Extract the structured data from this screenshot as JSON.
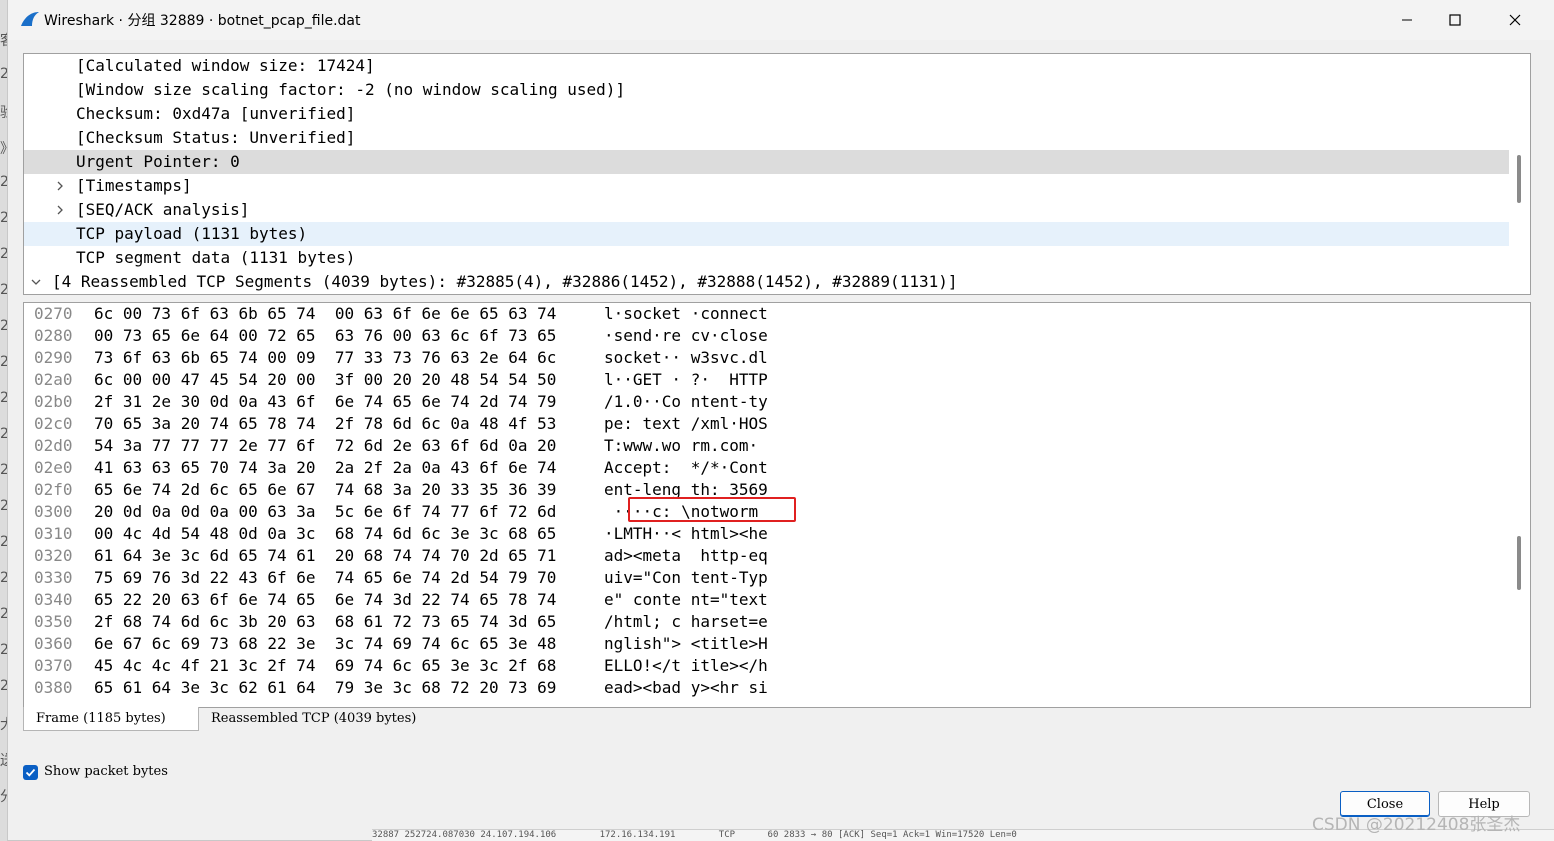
{
  "window": {
    "title": "Wireshark · 分组 32889 · botnet_pcap_file.dat"
  },
  "icons": {
    "app": "wireshark-fin-icon",
    "minimize": "minimize-icon",
    "maximize": "maximize-icon",
    "close": "close-icon",
    "collapsed": "chevron-right-icon",
    "expanded": "chevron-down-icon",
    "checkbox": "checkmark-icon"
  },
  "colors": {
    "accent": "#0a5fc4",
    "selected_row": "#dcdcdc",
    "highlight_row": "#e6f1fb",
    "annotation_box": "#e02020"
  },
  "tree": {
    "rows": [
      {
        "text": "[Calculated window size: 17424]",
        "state": "leaf"
      },
      {
        "text": "[Window size scaling factor: -2 (no window scaling used)]",
        "state": "leaf"
      },
      {
        "text": "Checksum: 0xd47a [unverified]",
        "state": "leaf"
      },
      {
        "text": "[Checksum Status: Unverified]",
        "state": "leaf"
      },
      {
        "text": "Urgent Pointer: 0",
        "state": "selected"
      },
      {
        "text": "[Timestamps]",
        "state": "collapsed"
      },
      {
        "text": "[SEQ/ACK analysis]",
        "state": "collapsed"
      },
      {
        "text": "TCP payload (1131 bytes)",
        "state": "highlighted"
      },
      {
        "text": "TCP segment data (1131 bytes)",
        "state": "leaf"
      },
      {
        "text": "[4 Reassembled TCP Segments (4039 bytes): #32885(4), #32886(1452), #32888(1452), #32889(1131)]",
        "state": "expanded"
      }
    ]
  },
  "hex": {
    "rows": [
      {
        "offset": "0270",
        "bytes": "6c 00 73 6f 63 6b 65 74  00 63 6f 6e 6e 65 63 74",
        "ascii": "l·socket ·connect"
      },
      {
        "offset": "0280",
        "bytes": "00 73 65 6e 64 00 72 65  63 76 00 63 6c 6f 73 65",
        "ascii": "·send·re cv·close"
      },
      {
        "offset": "0290",
        "bytes": "73 6f 63 6b 65 74 00 09  77 33 73 76 63 2e 64 6c",
        "ascii": "socket·· w3svc.dl"
      },
      {
        "offset": "02a0",
        "bytes": "6c 00 00 47 45 54 20 00  3f 00 20 20 48 54 54 50",
        "ascii": "l··GET · ?·  HTTP"
      },
      {
        "offset": "02b0",
        "bytes": "2f 31 2e 30 0d 0a 43 6f  6e 74 65 6e 74 2d 74 79",
        "ascii": "/1.0··Co ntent-ty"
      },
      {
        "offset": "02c0",
        "bytes": "70 65 3a 20 74 65 78 74  2f 78 6d 6c 0a 48 4f 53",
        "ascii": "pe: text /xml·HOS"
      },
      {
        "offset": "02d0",
        "bytes": "54 3a 77 77 77 2e 77 6f  72 6d 2e 63 6f 6d 0a 20",
        "ascii": "T:www.wo rm.com· "
      },
      {
        "offset": "02e0",
        "bytes": "41 63 63 65 70 74 3a 20  2a 2f 2a 0a 43 6f 6e 74",
        "ascii": "Accept:  */*·Cont"
      },
      {
        "offset": "02f0",
        "bytes": "65 6e 74 2d 6c 65 6e 67  74 68 3a 20 33 35 36 39",
        "ascii": "ent-leng th: 3569"
      },
      {
        "offset": "0300",
        "bytes": "20 0d 0a 0d 0a 00 63 3a  5c 6e 6f 74 77 6f 72 6d",
        "ascii": " ····c: \\notworm"
      },
      {
        "offset": "0310",
        "bytes": "00 4c 4d 54 48 0d 0a 3c  68 74 6d 6c 3e 3c 68 65",
        "ascii": "·LMTH··< html><he"
      },
      {
        "offset": "0320",
        "bytes": "61 64 3e 3c 6d 65 74 61  20 68 74 74 70 2d 65 71",
        "ascii": "ad><meta  http-eq"
      },
      {
        "offset": "0330",
        "bytes": "75 69 76 3d 22 43 6f 6e  74 65 6e 74 2d 54 79 70",
        "ascii": "uiv=\"Con tent-Typ"
      },
      {
        "offset": "0340",
        "bytes": "65 22 20 63 6f 6e 74 65  6e 74 3d 22 74 65 78 74",
        "ascii": "e\" conte nt=\"text"
      },
      {
        "offset": "0350",
        "bytes": "2f 68 74 6d 6c 3b 20 63  68 61 72 73 65 74 3d 65",
        "ascii": "/html; c harset=e"
      },
      {
        "offset": "0360",
        "bytes": "6e 67 6c 69 73 68 22 3e  3c 74 69 74 6c 65 3e 48",
        "ascii": "nglish\"> <title>H"
      },
      {
        "offset": "0370",
        "bytes": "45 4c 4c 4f 21 3c 2f 74  69 74 6c 65 3e 3c 2f 68",
        "ascii": "ELLO!</t itle></h"
      },
      {
        "offset": "0380",
        "bytes": "65 61 64 3e 3c 62 61 64  79 3e 3c 68 72 20 73 69",
        "ascii": "ead><bad y><hr si"
      }
    ]
  },
  "tabs": [
    {
      "label": "Frame (1185 bytes)",
      "active": true
    },
    {
      "label": "Reassembled TCP (4039 bytes)",
      "active": false
    }
  ],
  "show_packet_bytes": {
    "label": "Show packet bytes",
    "checked": true
  },
  "buttons": {
    "close": "Close",
    "help": "Help"
  },
  "background_packet_line": "32887 252724.087030 24.107.194.106        172.16.134.191        TCP      60 2833 → 80 [ACK] Seq=1 Ack=1 Win=17520 Len=0",
  "watermark": "CSDN @20212408张圣杰",
  "left_edge_glyphs": [
    "客",
    "2",
    "验",
    "》",
    "2",
    "2",
    "2",
    "2",
    "2",
    "2",
    "2",
    "2",
    "2",
    "2",
    "2",
    "2",
    "2",
    "2",
    "2",
    "大",
    "送",
    "分"
  ]
}
